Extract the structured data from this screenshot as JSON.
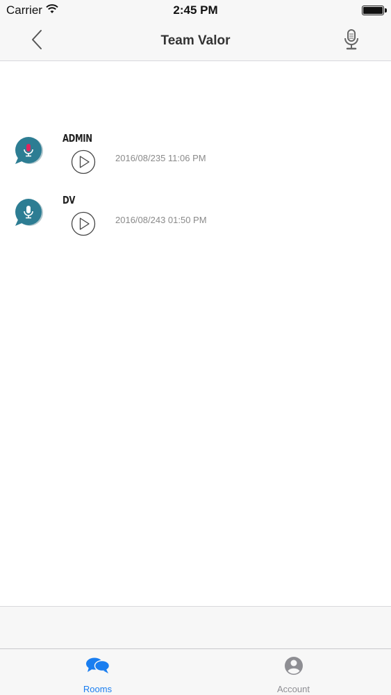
{
  "status_bar": {
    "carrier": "Carrier",
    "time": "2:45 PM"
  },
  "nav": {
    "title": "Team Valor",
    "back_icon": "chevron-left-icon",
    "mic_icon": "microphone-icon"
  },
  "messages": [
    {
      "sender": "ADMIN",
      "timestamp": "2016/08/235 11:06 PM",
      "mic_color": "#e0245e"
    },
    {
      "sender": "DV",
      "timestamp": "2016/08/243 01:50 PM",
      "mic_color": "#ffffff"
    }
  ],
  "tabs": [
    {
      "label": "Rooms",
      "icon": "chat-bubbles-icon",
      "active": true
    },
    {
      "label": "Account",
      "icon": "account-icon",
      "active": false
    }
  ],
  "colors": {
    "accent": "#1a7ef0",
    "avatar_bubble": "#2d7d93",
    "inactive_tab": "#8e8e93"
  }
}
